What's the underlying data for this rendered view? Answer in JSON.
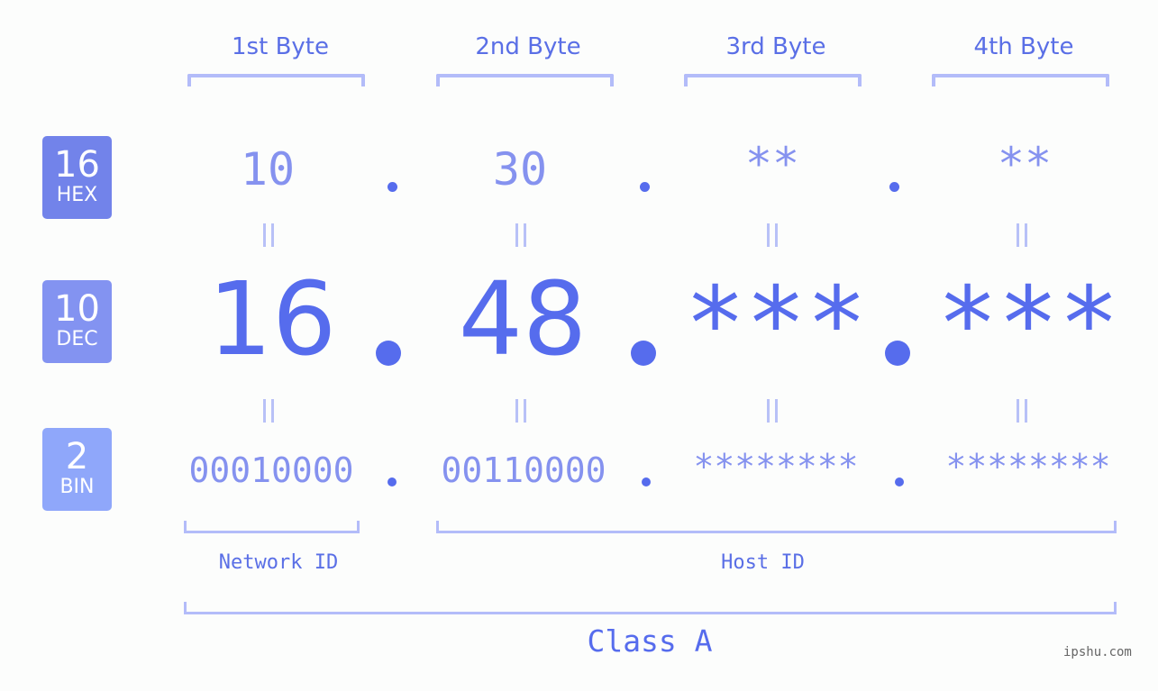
{
  "bytes": [
    {
      "header": "1st Byte",
      "hex": "10",
      "dec": "16",
      "bin": "00010000"
    },
    {
      "header": "2nd Byte",
      "hex": "30",
      "dec": "48",
      "bin": "00110000"
    },
    {
      "header": "3rd Byte",
      "hex": "**",
      "dec": "***",
      "bin": "********"
    },
    {
      "header": "4th Byte",
      "hex": "**",
      "dec": "***",
      "bin": "********"
    }
  ],
  "badges": {
    "hex": {
      "number": "16",
      "label": "HEX",
      "color": "#7283ea"
    },
    "dec": {
      "number": "10",
      "label": "DEC",
      "color": "#8393f1"
    },
    "bin": {
      "number": "2",
      "label": "BIN",
      "color": "#8fa7fa"
    }
  },
  "separator": ".",
  "labels": {
    "network_id": "Network ID",
    "host_id": "Host ID",
    "class": "Class A"
  },
  "watermark": "ipshu.com",
  "colors": {
    "accent": "#566ced",
    "light_accent": "#8592ef",
    "bracket": "#b3bcf9",
    "background": "#fcfdfc"
  }
}
